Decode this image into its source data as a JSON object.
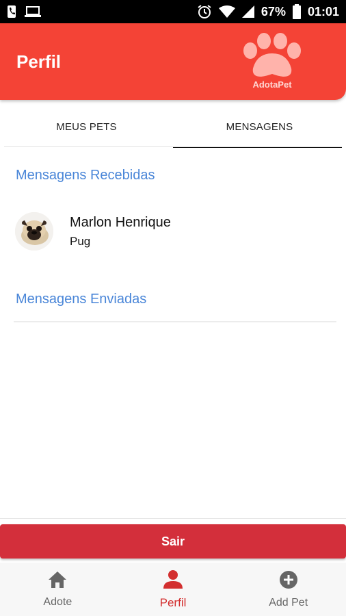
{
  "status_bar": {
    "battery": "67%",
    "time": "01:01",
    "icons": [
      "phone-icon",
      "laptop-icon",
      "alarm-icon",
      "wifi-icon",
      "signal-icon",
      "battery-icon"
    ]
  },
  "header": {
    "title": "Perfil",
    "logo_text": "AdotaPet",
    "color": "#f44336"
  },
  "tabs": [
    {
      "label": "MEUS PETS",
      "active": false
    },
    {
      "label": "MENSAGENS",
      "active": true
    }
  ],
  "received": {
    "title": "Mensagens Recebidas",
    "messages": [
      {
        "name": "Marlon Henrique",
        "pet": "Pug"
      }
    ]
  },
  "sent": {
    "title": "Mensagens Enviadas"
  },
  "logout_label": "Sair",
  "bottom_nav": [
    {
      "label": "Adote",
      "icon": "home-icon",
      "active": false
    },
    {
      "label": "Perfil",
      "icon": "person-icon",
      "active": true
    },
    {
      "label": "Add Pet",
      "icon": "add-circle-icon",
      "active": false
    }
  ],
  "colors": {
    "accent": "#f44336",
    "button": "#d32f3b",
    "link": "#4a86d8",
    "active_nav": "#d32f2f"
  }
}
